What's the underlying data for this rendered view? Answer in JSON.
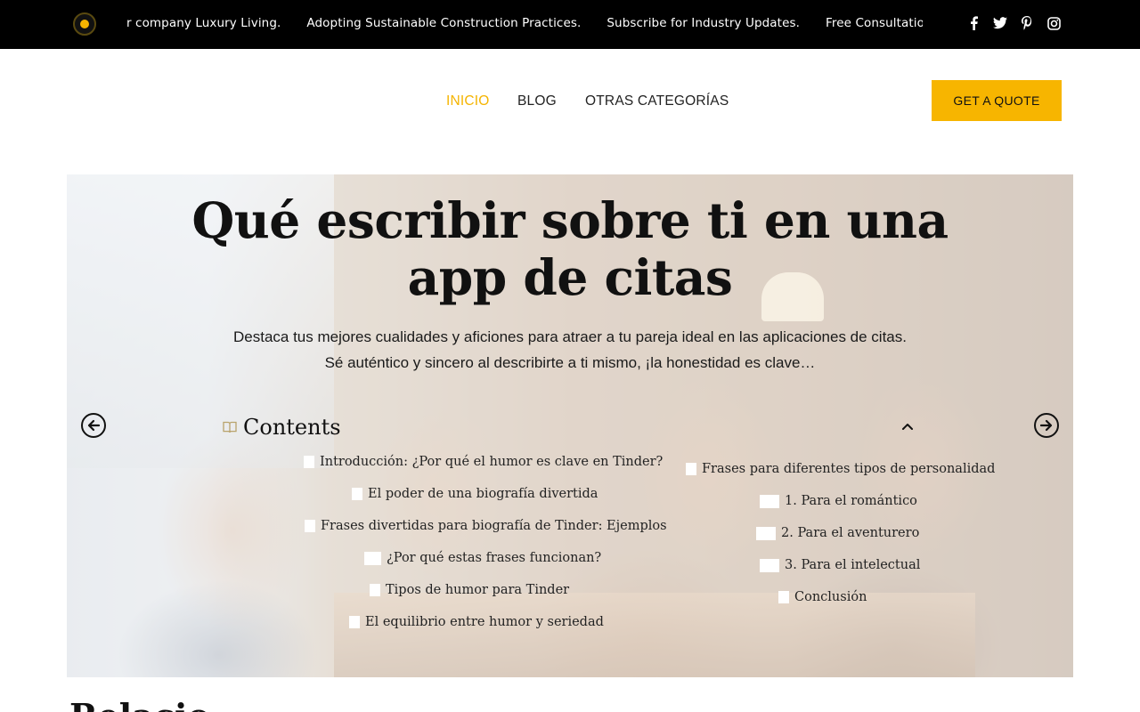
{
  "topbar": {
    "ticker": [
      "r company Luxury Living.",
      "Adopting Sustainable Construction Practices.",
      "Subscribe for Industry Updates.",
      "Free Consultation: Li"
    ],
    "social": [
      "facebook-icon",
      "twitter-icon",
      "pinterest-icon",
      "instagram-icon"
    ],
    "accent": "#f5b400"
  },
  "nav": {
    "items": [
      "INICIO",
      "BLOG",
      "OTRAS CATEGORÍAS"
    ],
    "active_item": "INICIO",
    "quote_label": "GET A QUOTE"
  },
  "hero": {
    "title": "Qué escribir sobre ti en una app de citas",
    "subtitle": "Destaca tus mejores cualidades y aficiones para atraer a tu pareja ideal en las aplicaciones de citas. Sé auténtico y sincero al describirte a ti mismo, ¡la honestidad es clave…",
    "toc": {
      "title": "Contents",
      "left_items": [
        "Introducción: ¿Por qué el humor es clave en Tinder?",
        "El poder de una biografía divertida",
        "Frases divertidas para biografía de Tinder: Ejemplos",
        "¿Por qué estas frases funcionan?",
        "Tipos de humor para Tinder",
        "El equilibrio entre humor y seriedad"
      ],
      "right_items": [
        "Frases para diferentes tipos de personalidad",
        "1. Para el romántico",
        "2. Para el aventurero",
        "3. Para el intelectual",
        "Conclusión"
      ]
    }
  },
  "below": {
    "heading": "Relacio"
  }
}
